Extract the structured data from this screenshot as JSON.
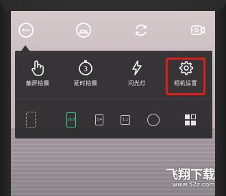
{
  "toolbar": {
    "items": [
      {
        "name": "more-icon"
      },
      {
        "name": "gallery-icon"
      },
      {
        "name": "rotate-camera-icon"
      },
      {
        "name": "settings-share-icon"
      }
    ]
  },
  "panel": {
    "modes": [
      {
        "label": "触屏拍摄",
        "icon": "touch-icon"
      },
      {
        "label": "延时拍摄",
        "icon": "timer-icon",
        "timer_value": "3"
      },
      {
        "label": "闪光灯",
        "icon": "flash-icon"
      },
      {
        "label": "相机设置",
        "icon": "gear-icon",
        "highlighted": true
      }
    ],
    "ratios": [
      {
        "name": "ratio-full-icon",
        "label": ""
      },
      {
        "name": "ratio-16-9",
        "label": "16:9",
        "active": true
      },
      {
        "name": "ratio-3-4",
        "label": "3:4"
      },
      {
        "name": "ratio-1-1",
        "label": "1:1"
      },
      {
        "name": "ratio-circle",
        "label": ""
      },
      {
        "name": "ratio-grid-icon",
        "label": ""
      }
    ]
  },
  "watermark": {
    "title": "飞翔下载",
    "url": "www.52z.com"
  },
  "colors": {
    "highlight": "#e21b1b",
    "active": "#39d98a",
    "panel": "#1c1c1e"
  }
}
